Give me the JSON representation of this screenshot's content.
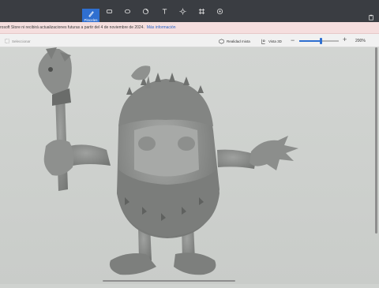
{
  "toolbar": {
    "tools": [
      {
        "name": "brushes",
        "label": "Pinceles",
        "icon": "brush-icon",
        "active": true
      },
      {
        "name": "shapes-2d",
        "label": "",
        "icon": "shapes-2d-icon"
      },
      {
        "name": "shapes-3d",
        "label": "",
        "icon": "shapes-3d-icon"
      },
      {
        "name": "stickers",
        "label": "",
        "icon": "sticker-icon"
      },
      {
        "name": "text",
        "label": "",
        "icon": "text-icon"
      },
      {
        "name": "effects",
        "label": "",
        "icon": "effects-icon"
      },
      {
        "name": "canvas",
        "label": "",
        "icon": "canvas-icon"
      },
      {
        "name": "library-3d",
        "label": "",
        "icon": "library-3d-icon"
      }
    ],
    "accent": "#2f6fd0"
  },
  "notice": {
    "text": "rosoft Store ni recibirá actualizaciones futuras a partir del 4 de noviembre de 2024.",
    "link": "Más información"
  },
  "subbar": {
    "select_placeholder": "Seleccionar",
    "mixed_reality": "Realidad mixta",
    "view_3d": "Vista 3D",
    "zoom": "200%",
    "zoom_level": 0.55
  },
  "canvas": {
    "object": "3D creature model"
  }
}
